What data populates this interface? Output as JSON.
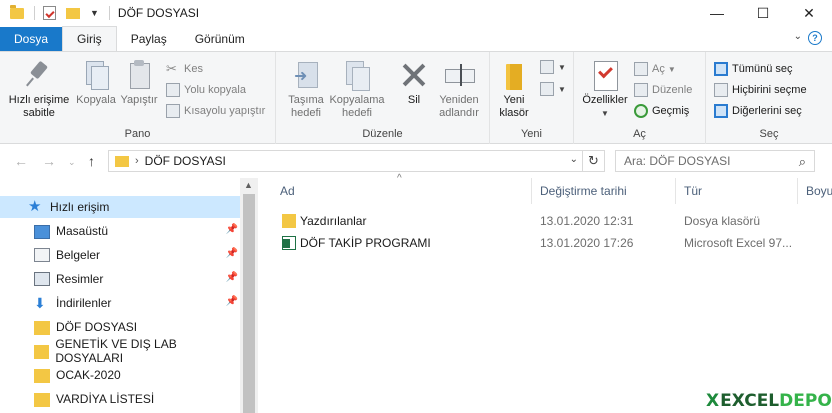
{
  "window": {
    "title": "DÖF DOSYASI",
    "controls": {
      "minimize": "—",
      "maximize": "☐",
      "close": "✕"
    }
  },
  "ribbon_tabs": [
    "Dosya",
    "Giriş",
    "Paylaş",
    "Görünüm"
  ],
  "ribbon": {
    "pano": {
      "label": "Pano",
      "pin": "Hızlı erişime sabitle",
      "copy": "Kopyala",
      "paste": "Yapıştır",
      "cut": "Kes",
      "copy_path": "Yolu kopyala",
      "paste_shortcut": "Kısayolu yapıştır"
    },
    "duzenle": {
      "label": "Düzenle",
      "move_to": "Taşıma hedefi",
      "copy_to": "Kopyalama hedefi",
      "delete": "Sil",
      "rename": "Yeniden adlandır"
    },
    "yeni": {
      "label": "Yeni",
      "new_folder": "Yeni klasör"
    },
    "ac": {
      "label": "Aç",
      "properties": "Özellikler",
      "open": "Aç",
      "edit": "Düzenle",
      "history": "Geçmiş"
    },
    "sec": {
      "label": "Seç",
      "select_all": "Tümünü seç",
      "select_none": "Hiçbirini seçme",
      "invert": "Diğerlerini seç"
    }
  },
  "address": {
    "path": "DÖF DOSYASI",
    "search_placeholder": "Ara: DÖF DOSYASI"
  },
  "nav_pane": [
    {
      "label": "Hızlı erişim",
      "icon": "star-icon",
      "selected": true,
      "pinned": false
    },
    {
      "label": "Masaüstü",
      "icon": "desktop-icon",
      "selected": false,
      "pinned": true
    },
    {
      "label": "Belgeler",
      "icon": "documents-icon",
      "selected": false,
      "pinned": true
    },
    {
      "label": "Resimler",
      "icon": "pictures-icon",
      "selected": false,
      "pinned": true
    },
    {
      "label": "İndirilenler",
      "icon": "download-icon",
      "selected": false,
      "pinned": true
    },
    {
      "label": "DÖF DOSYASI",
      "icon": "folder-icon",
      "selected": false,
      "pinned": false
    },
    {
      "label": "GENETİK VE DIŞ LAB DOSYALARI",
      "icon": "folder-icon",
      "selected": false,
      "pinned": false
    },
    {
      "label": "OCAK-2020",
      "icon": "folder-icon",
      "selected": false,
      "pinned": false
    },
    {
      "label": "VARDİYA LİSTESİ",
      "icon": "folder-icon",
      "selected": false,
      "pinned": false
    }
  ],
  "columns": [
    "Ad",
    "Değiştirme tarihi",
    "Tür",
    "Boyut"
  ],
  "files": [
    {
      "name": "Yazdırılanlar",
      "date": "13.01.2020 12:31",
      "type": "Dosya klasörü",
      "icon": "folder-icon"
    },
    {
      "name": "DÖF TAKİP PROGRAMI",
      "date": "13.01.2020 17:26",
      "type": "Microsoft Excel 97...",
      "icon": "excel-file-icon"
    }
  ],
  "watermark": {
    "x": "X",
    "excel": "EXCEL",
    "depo": "DEPO"
  }
}
